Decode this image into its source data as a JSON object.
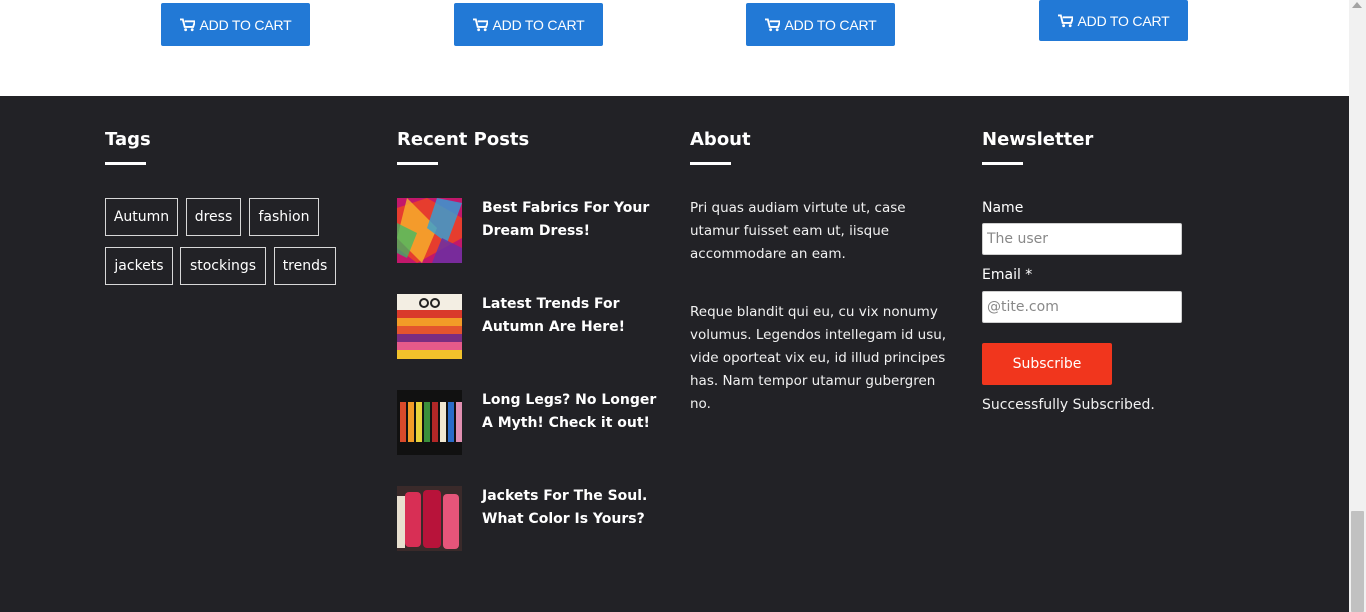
{
  "products": {
    "add_to_cart_label": "ADD TO CART"
  },
  "footer": {
    "tags": {
      "heading": "Tags",
      "items": [
        "Autumn",
        "dress",
        "fashion",
        "jackets",
        "stockings",
        "trends"
      ]
    },
    "recent_posts": {
      "heading": "Recent Posts",
      "items": [
        {
          "title": "Best Fabrics For Your Dream Dress!"
        },
        {
          "title": "Latest Trends For Autumn Are Here!"
        },
        {
          "title": "Long Legs? No Longer A Myth! Check it out!"
        },
        {
          "title": "Jackets For The Soul. What Color Is Yours?"
        }
      ]
    },
    "about": {
      "heading": "About",
      "paragraphs": [
        "Pri quas audiam virtute ut, case utamur fuisset eam ut, iisque accommodare an eam.",
        "Reque blandit qui eu, cu vix nonumy volumus. Legendos intellegam id usu, vide oporteat vix eu, id illud principes has. Nam tempor utamur gubergren no."
      ]
    },
    "newsletter": {
      "heading": "Newsletter",
      "name_label": "Name",
      "name_placeholder": "The user",
      "email_label": "Email *",
      "email_placeholder": "@tite.com",
      "subscribe_label": "Subscribe",
      "status_text": "Successfully Subscribed."
    }
  },
  "colors": {
    "primary_button": "#2279d6",
    "footer_background": "#222226",
    "subscribe_button": "#f1361d"
  }
}
